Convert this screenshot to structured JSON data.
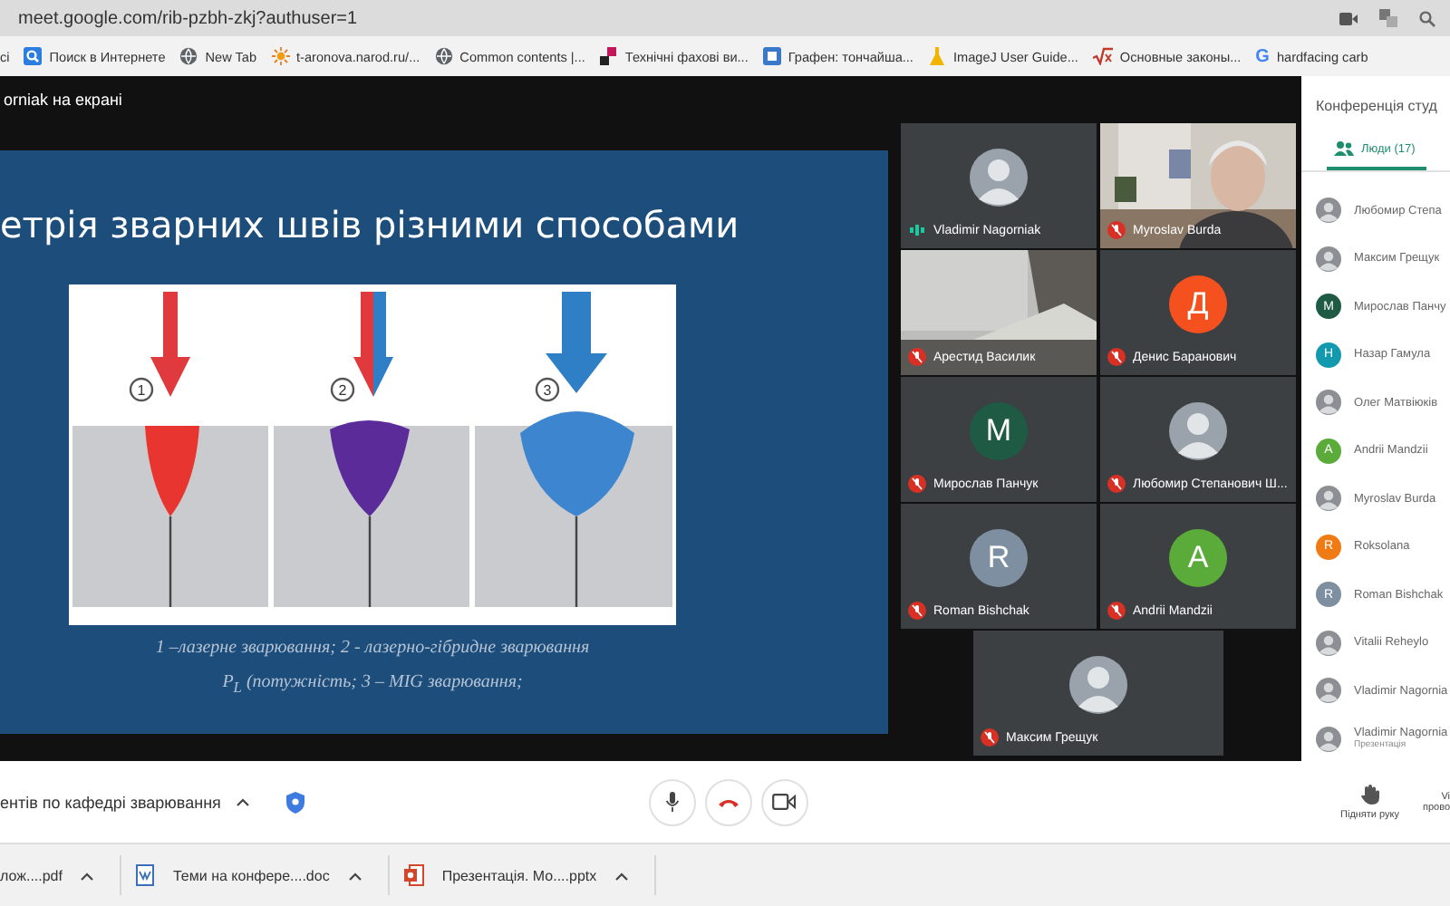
{
  "browser": {
    "url": "meet.google.com/rib-pzbh-zkj?authuser=1"
  },
  "bookmarks": [
    {
      "label": "ci"
    },
    {
      "label": "Поиск в Интернете",
      "kind": "search"
    },
    {
      "label": "New Tab",
      "kind": "globe"
    },
    {
      "label": "t-aronova.narod.ru/...",
      "kind": "sun"
    },
    {
      "label": "Common contents |...",
      "kind": "globe"
    },
    {
      "label": "Технічні фахові ви...",
      "kind": "tiles"
    },
    {
      "label": "Графен: тончайша...",
      "kind": "frame"
    },
    {
      "label": "ImageJ User Guide...",
      "kind": "flask"
    },
    {
      "label": "Основные законы...",
      "kind": "formula"
    },
    {
      "label": "hardfacing carb",
      "kind": "letter",
      "glyph": "G"
    }
  ],
  "meeting": {
    "presenting_label": "orniak на екрані",
    "title": "ентів по кафедрі зварювання"
  },
  "slide": {
    "title": "етрія зварних швів різними способами",
    "steps": [
      "1",
      "2",
      "3"
    ],
    "caption": [
      "1 –лазерне зварювання; 2 - лазерно-гібридне зварювання",
      "P$_{L}$ (потужність; 3 – MIG зварювання;"
    ]
  },
  "participants": [
    {
      "name": "Vladimir Nagorniak",
      "muted": false
    },
    {
      "name": "Myroslav Burda",
      "kind": "video",
      "muted": true
    },
    {
      "name": "Арестид Василик",
      "kind": "video",
      "muted": true
    },
    {
      "name": "Денис Баранович",
      "kind": "letter",
      "letter": "Д",
      "color": "#f4511e",
      "muted": true
    },
    {
      "name": "Мирослав Панчук",
      "kind": "letter",
      "letter": "M",
      "color": "#1e5a44",
      "muted": true
    },
    {
      "name": "Любомир Степанович Ш...",
      "muted": true
    },
    {
      "name": "Roman Bishchak",
      "kind": "letter",
      "letter": "R",
      "color": "#7d8fa1",
      "muted": true
    },
    {
      "name": "Andrii Mandzii",
      "kind": "letter",
      "letter": "A",
      "color": "#5aab3a",
      "muted": true
    },
    {
      "name": "Максим Грещук",
      "muted": true
    }
  ],
  "panel": {
    "title": "Конференція студ",
    "tab": {
      "label": "Люди (17)",
      "selected": true
    },
    "people": [
      {
        "name": "Любомир Степа"
      },
      {
        "name": "Максим Грещук"
      },
      {
        "name": "Мирослав Панчу",
        "kind": "letter",
        "letter": "M",
        "color": "#1e5a44"
      },
      {
        "name": "Назар Гамула",
        "kind": "letter",
        "letter": "H",
        "color": "#1299ad"
      },
      {
        "name": "Олег Матвіюків"
      },
      {
        "name": "Andrii Mandzii",
        "kind": "letter",
        "letter": "A",
        "color": "#5aab3a"
      },
      {
        "name": "Myroslav Burda"
      },
      {
        "name": "Roksolana",
        "kind": "letter",
        "letter": "R",
        "color": "#f07b14"
      },
      {
        "name": "Roman Bishchak",
        "kind": "letter",
        "letter": "R",
        "color": "#7d8fa1"
      },
      {
        "name": "Vitalii Reheylo"
      },
      {
        "name": "Vladimir Nagornia"
      },
      {
        "name": "Vladimir Nagornia",
        "subtitle": "Презентація"
      }
    ]
  },
  "controls": {
    "raise_hand": "Підняти руку",
    "cut_label": "Vi",
    "cut_sub": "прово"
  },
  "downloads": [
    {
      "name": "лож....pdf"
    },
    {
      "name": "Теми на конфере....doc",
      "kind": "doc"
    },
    {
      "name": "Презентація. Мо....pptx",
      "kind": "pptx"
    }
  ]
}
